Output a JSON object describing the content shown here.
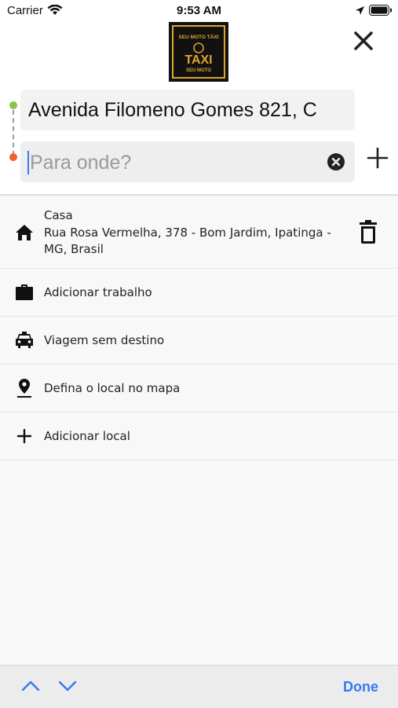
{
  "status_bar": {
    "carrier": "Carrier",
    "time": "9:53 AM"
  },
  "logo": {
    "top_text": "SEU MOTO TÁXI",
    "main_text": "TAXI",
    "bottom_text": "SEU MOTO",
    "colors": {
      "background": "#111111",
      "accent": "#e0a528"
    }
  },
  "search": {
    "origin_value": "Avenida Filomeno Gomes 821, C",
    "destination_value": "",
    "destination_placeholder": "Para onde?"
  },
  "saved_places": {
    "home": {
      "label": "Casa",
      "address": "Rua Rosa Vermelha, 378 - Bom Jardim, Ipatinga - MG, Brasil",
      "icon": "home-icon",
      "action_icon": "trash-icon"
    },
    "items": [
      {
        "label": "Adicionar trabalho",
        "icon": "briefcase-icon"
      },
      {
        "label": "Viagem sem destino",
        "icon": "taxi-icon"
      },
      {
        "label": "Defina o local no mapa",
        "icon": "map-pin-icon"
      },
      {
        "label": "Adicionar local",
        "icon": "plus-icon"
      }
    ]
  },
  "keyboard_toolbar": {
    "done_label": "Done"
  },
  "colors": {
    "accent": "#3478f6",
    "route_start": "#8bc34a",
    "route_end": "#f0622d"
  }
}
